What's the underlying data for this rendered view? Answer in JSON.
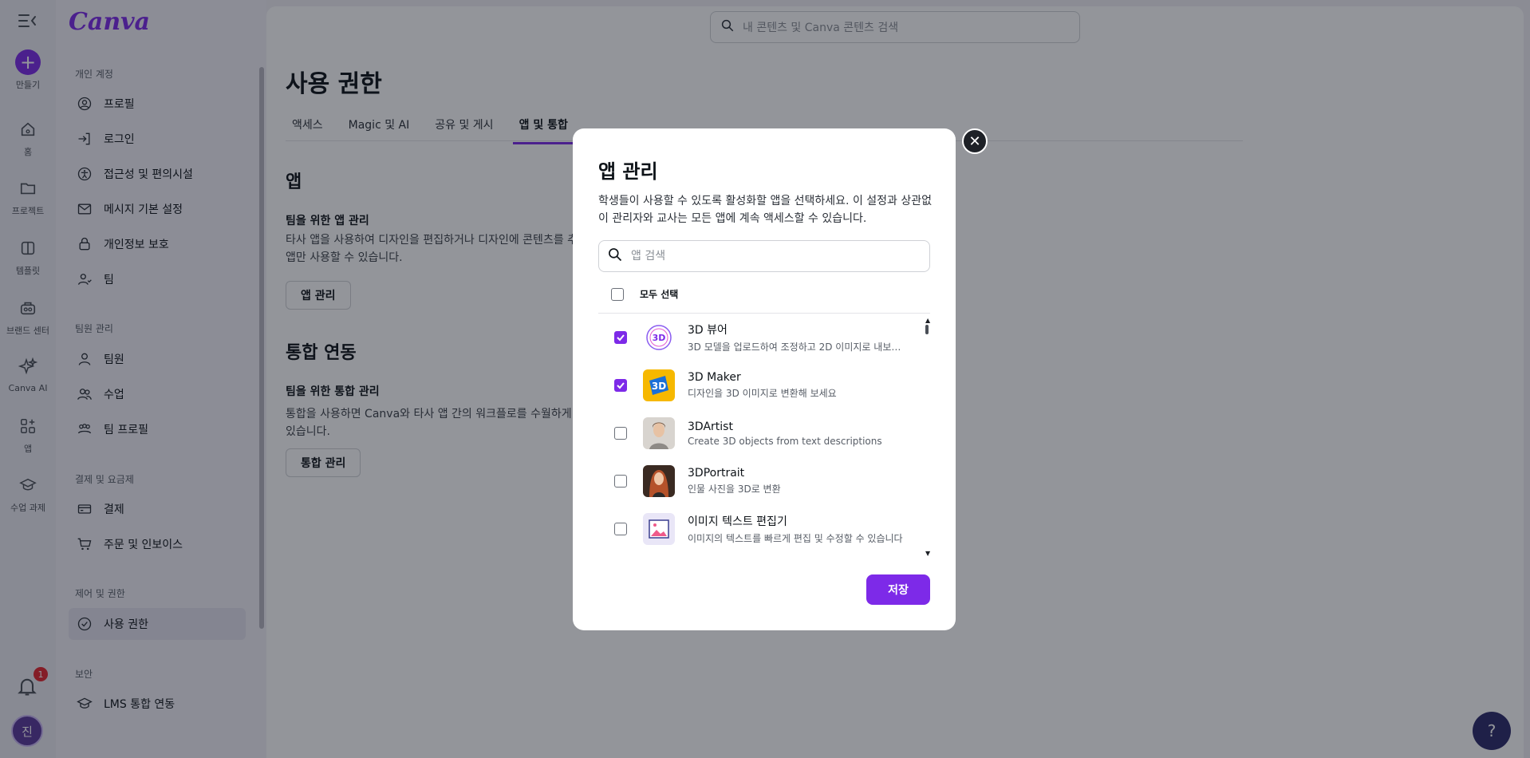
{
  "rail": {
    "create_label": "만들기",
    "home_label": "홈",
    "projects_label": "프로젝트",
    "templates_label": "템플릿",
    "brand_label": "브랜드 센터",
    "canva_ai_label": "Canva AI",
    "apps_label": "앱",
    "assignments_label": "수업 과제",
    "notification_count": "1",
    "avatar_initial": "진"
  },
  "brand": {
    "logo": "Canva"
  },
  "sidebar": {
    "sections": [
      {
        "title": "개인 계정",
        "items": [
          "프로필",
          "로그인",
          "접근성 및 편의시설",
          "메시지 기본 설정",
          "개인정보 보호",
          "팀"
        ]
      },
      {
        "title": "팀원 관리",
        "items": [
          "팀원",
          "수업",
          "팀 프로필"
        ]
      },
      {
        "title": "결제 및 요금제",
        "items": [
          "결제",
          "주문 및 인보이스"
        ]
      },
      {
        "title": "제어 및 권한",
        "items": [
          "사용 권한"
        ]
      },
      {
        "title": "보안",
        "items": [
          "LMS 통합 연동"
        ]
      }
    ],
    "active_item": "사용 권한"
  },
  "top_search": {
    "placeholder": "내 콘텐츠 및 Canva 콘텐츠 검색"
  },
  "page": {
    "title": "사용 권한",
    "tabs": [
      "액세스",
      "Magic 및 AI",
      "공유 및 게시",
      "앱 및 통합"
    ],
    "active_tab": "앱 및 통합",
    "apps_heading": "앱",
    "apps_sub": "팀을 위한 앱 관리",
    "apps_desc_1": "타사 앱을 사용하여 디자인을 편집하거나 디자인에 콘텐츠를 추",
    "apps_desc_2": "앱만 사용할 수 있습니다.",
    "apps_button": "앱 관리",
    "integrations_heading": "통합 연동",
    "integrations_sub": "팀을 위한 통합 관리",
    "integrations_desc_1": "통합을 사용하면 Canva와 타사 앱 간의 워크플로를 수월하게 진",
    "integrations_desc_2": "있습니다.",
    "integrations_button": "통합 관리"
  },
  "modal": {
    "title": "앱 관리",
    "description": "학생들이 사용할 수 있도록 활성화할 앱을 선택하세요. 이 설정과 상관없이 관리자와 교사는 모든 앱에 계속 액세스할 수 있습니다.",
    "search_placeholder": "앱 검색",
    "select_all_label": "모두 선택",
    "apps": [
      {
        "name": "3D 뷰어",
        "description": "3D 모델을 업로드하여 조정하고 2D 이미지로 내보내...",
        "checked": true,
        "icon": "3d-viewer-icon"
      },
      {
        "name": "3D Maker",
        "description": "디자인을 3D 이미지로 변환해 보세요",
        "checked": true,
        "icon": "3d-maker-icon"
      },
      {
        "name": "3DArtist",
        "description": "Create 3D objects from text descriptions",
        "checked": false,
        "icon": "3dartist-portrait-icon"
      },
      {
        "name": "3DPortrait",
        "description": "인물 사진을 3D로 변환",
        "checked": false,
        "icon": "3dportrait-icon"
      },
      {
        "name": "이미지 텍스트 편집기",
        "description": "이미지의 텍스트를 빠르게 편집 및 수정할 수 있습니다",
        "checked": false,
        "icon": "image-text-editor-icon"
      }
    ],
    "save_label": "저장",
    "close_glyph": "✕"
  },
  "help": {
    "glyph": "?"
  },
  "colors": {
    "accent": "#7d2ae8",
    "overlay": "rgba(15,20,30,0.45)"
  }
}
